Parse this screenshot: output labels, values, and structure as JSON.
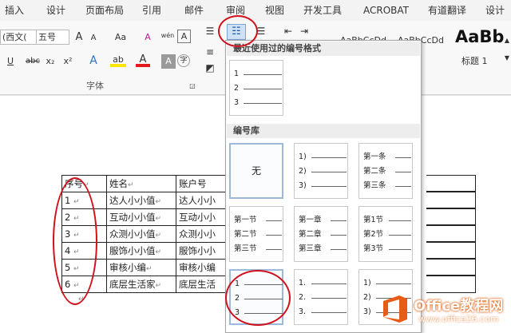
{
  "ribbon_tabs": [
    "插入",
    "设计",
    "页面布局",
    "引用",
    "邮件",
    "审阅",
    "视图",
    "开发工具",
    "ACROBAT",
    "有道翻译",
    "设计"
  ],
  "font_group": {
    "font_name": "(西文(",
    "font_size": "五号",
    "grow": "A",
    "shrink": "A",
    "case": "Aa",
    "clear": "A",
    "pinyin": "wén",
    "border_char": "A",
    "underline": "U",
    "strike": "abc",
    "subscript": "x₂",
    "superscript": "x²",
    "text_effect": "A",
    "highlight": "ab",
    "font_color": "A",
    "shade": "A",
    "enclose": "字",
    "label": "字体"
  },
  "styles_gallery": {
    "style1": "AaBbCcDd",
    "style2": "AaBbCcDd",
    "style3": "AaBb",
    "style3_label": "标题 1"
  },
  "numbering_panel": {
    "recent_header": "最近使用过的编号格式",
    "recent": [
      "1",
      "2",
      "3"
    ],
    "library_header": "编号库",
    "tiles": [
      {
        "type": "none",
        "label": "无"
      },
      {
        "type": "list",
        "items": [
          "1)",
          "2)",
          "3)"
        ]
      },
      {
        "type": "list",
        "items": [
          "第一条",
          "第二条",
          "第三条"
        ]
      },
      {
        "type": "list",
        "items": [
          "第一节",
          "第二节",
          "第三节"
        ]
      },
      {
        "type": "list",
        "items": [
          "第一章",
          "第二章",
          "第三章"
        ]
      },
      {
        "type": "list",
        "items": [
          "第1节",
          "第2节",
          "第3节"
        ]
      },
      {
        "type": "list",
        "items": [
          "1",
          "2",
          "3"
        ]
      },
      {
        "type": "list",
        "items": [
          "1.",
          "2.",
          "3."
        ]
      },
      {
        "type": "list",
        "items": [
          "1)",
          "2)",
          "3)"
        ]
      }
    ]
  },
  "table": {
    "headers": [
      "序号",
      "姓名",
      "账户号"
    ],
    "rows": [
      [
        "1",
        "达人小小值",
        "达人小小"
      ],
      [
        "2",
        "互动小小值",
        "互动小小"
      ],
      [
        "3",
        "众测小小值",
        "众测小小"
      ],
      [
        "4",
        "服饰小小值",
        "服饰小小"
      ],
      [
        "5",
        "审核小编",
        "审核小编"
      ],
      [
        "6",
        "底层生活家",
        "底层生活"
      ]
    ],
    "return_mark": "↵"
  },
  "watermark": {
    "line1": "Office教程网",
    "line2": "www.office26.com"
  },
  "colors": {
    "annotation_red": "#d0101a",
    "highlight_yellow": "#ffe600",
    "font_color_red": "#e11b1b",
    "watermark_orange": "#e06a1b"
  }
}
